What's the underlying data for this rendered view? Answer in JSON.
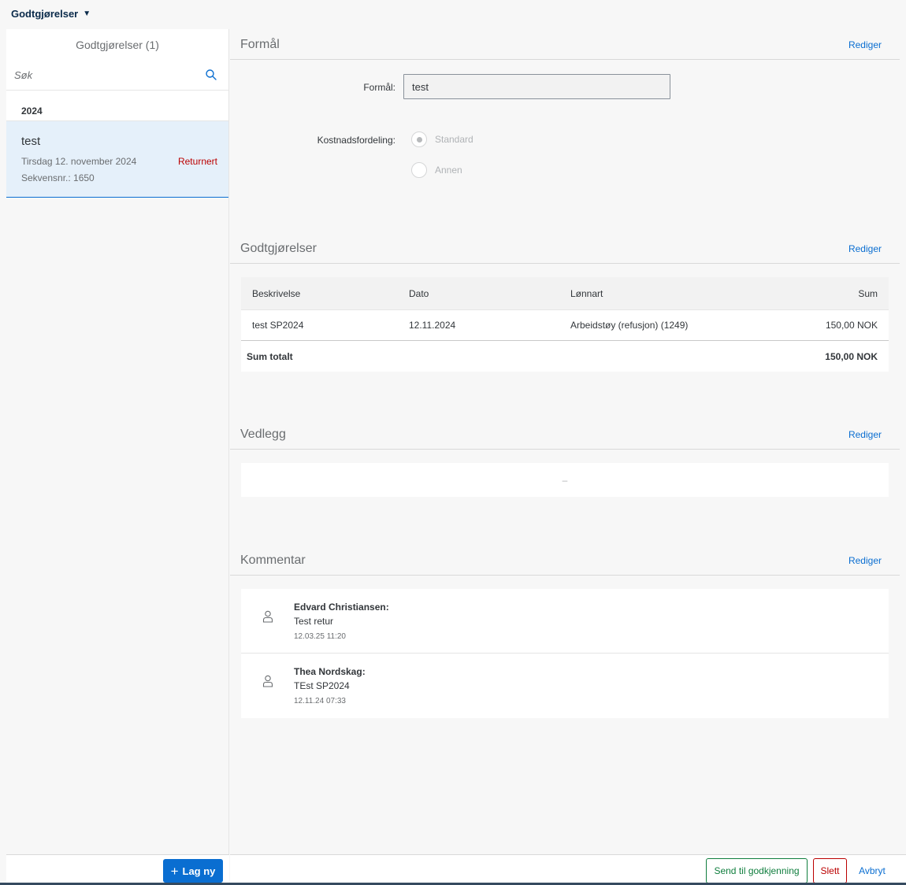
{
  "shell": {
    "title": "Godtgjørelser"
  },
  "master": {
    "header": "Godtgjørelser (1)",
    "search_placeholder": "Søk",
    "group": "2024",
    "items": [
      {
        "title": "test",
        "date": "Tirsdag 12. november 2024",
        "status": "Returnert",
        "sequence": "Sekvensnr.: 1650"
      }
    ],
    "new_button": "Lag ny"
  },
  "sections": {
    "formal": {
      "title": "Formål",
      "edit": "Rediger",
      "field_label": "Formål:",
      "field_value": "test",
      "distribution_label": "Kostnadsfordeling:",
      "options": [
        {
          "label": "Standard",
          "selected": true
        },
        {
          "label": "Annen",
          "selected": false
        }
      ]
    },
    "allowances": {
      "title": "Godtgjørelser",
      "edit": "Rediger",
      "columns": [
        "Beskrivelse",
        "Dato",
        "Lønnart",
        "Sum"
      ],
      "rows": [
        {
          "description": "test SP2024",
          "date": "12.11.2024",
          "wage_type": "Arbeidstøy (refusjon) (1249)",
          "sum": "150,00 NOK"
        }
      ],
      "total_label": "Sum totalt",
      "total_value": "150,00 NOK"
    },
    "attachments": {
      "title": "Vedlegg",
      "edit": "Rediger",
      "empty": "–"
    },
    "comments": {
      "title": "Kommentar",
      "edit": "Rediger",
      "items": [
        {
          "author": "Edvard Christiansen:",
          "text": "Test retur",
          "time": "12.03.25 11:20"
        },
        {
          "author": "Thea Nordskag:",
          "text": "TEst SP2024",
          "time": "12.11.24 07:33"
        }
      ]
    }
  },
  "footer": {
    "send": "Send til godkjenning",
    "delete": "Slett",
    "cancel": "Avbryt"
  },
  "colors": {
    "accent": "#0a6ed1",
    "positive": "#107e3e",
    "negative": "#bb0000",
    "selected_bg": "#e5f0fa"
  }
}
